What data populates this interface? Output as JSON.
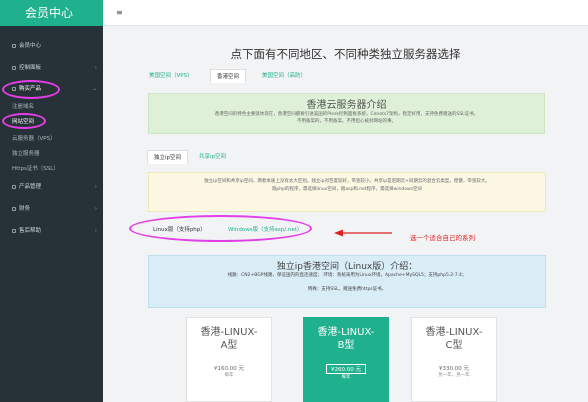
{
  "app": {
    "brand": "会员中心"
  },
  "sidebar": {
    "items": [
      {
        "label": "会员中心"
      },
      {
        "label": "控制面板"
      },
      {
        "label": "购买产品"
      },
      {
        "label": "产品管理"
      },
      {
        "label": "财务"
      },
      {
        "label": "售后帮助"
      }
    ],
    "sub_items": [
      {
        "label": "注册域名"
      },
      {
        "label": "网站空间"
      },
      {
        "label": "云服务器（VPS）"
      },
      {
        "label": "独立服务器"
      },
      {
        "label": "Https证书（SSL）"
      }
    ]
  },
  "topbar": {
    "menu_icon": "≡"
  },
  "main": {
    "heading": "点下面有不同地区、不同种类独立服务器选择",
    "region_tabs": [
      {
        "label": "美国空间（VPS）"
      },
      {
        "label": "香港空间"
      },
      {
        "label": "美国空间（高防）"
      }
    ],
    "info": {
      "title": "香港云服务器介绍",
      "line1": "香港空间的特色主要就体现在，香港空间都要引进美国的Plesk控制面板系统，Cenots7架构，稳定好用，支持免费赠送的SSL证书。",
      "line2": "不用备案的，不用备案，不用担心被封网站的事。"
    },
    "ip_tabs": [
      {
        "label": "独立ip空间"
      },
      {
        "label": "共享ip空间"
      }
    ],
    "warning": {
      "line1": "独立ip空间和共享ip空间，两者本质上没有太大区别。独立ip对百度较好，带宽较小，共享ip是后期云+同期云的混合云类型，稳健，带宽较大。",
      "line2": "跑php的程序，需选择linux空间，跑asp和.net程序，需选择windows空间"
    },
    "os_tabs": [
      {
        "label": "Linux版（支持php）"
      },
      {
        "label": "Windows版（支持asp/.net）"
      }
    ],
    "annotation": "选一个适合自己的系列",
    "linux_intro": {
      "title": "独立ip香港空间（Linux版）介绍：",
      "line1": "线路：CN2+BGP线路，保证国内的直连速度；  环境：系统采用为Linux环境，Apache+MySQL5；支持php5.2-7.4；",
      "line2": "特殊：支持SSL，赠送免费https证书。"
    },
    "plans": [
      {
        "name_line1": "香港-LINUX-",
        "name_line2": "A型",
        "price": "¥160.00 元",
        "unit": "每年"
      },
      {
        "name_line1": "香港-LINUX-",
        "name_line2": "B型",
        "price": "¥260.00 元",
        "unit": "每年"
      },
      {
        "name_line1": "香港-LINUX-",
        "name_line2": "C型",
        "price": "¥330.00 元",
        "unit": "另一年，另一年"
      }
    ]
  },
  "colors": {
    "brand": "#1fb08d",
    "sidebar": "#263238",
    "ring": "#e33fe6",
    "annotation": "#e02020"
  }
}
